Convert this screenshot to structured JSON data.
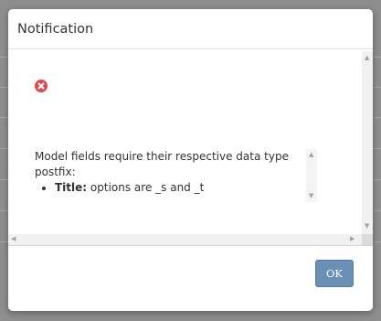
{
  "dialog": {
    "title": "Notification",
    "icon": "error-circle-icon",
    "message": {
      "intro": "Model fields require their respective data type postfix:",
      "items": [
        {
          "label": "Title:",
          "text": "options are _s and _t"
        }
      ]
    },
    "ok_label": "OK"
  },
  "colors": {
    "error_red": "#e2474d",
    "ok_button": "#6b8fb5",
    "backdrop": "#8e8e8e"
  }
}
